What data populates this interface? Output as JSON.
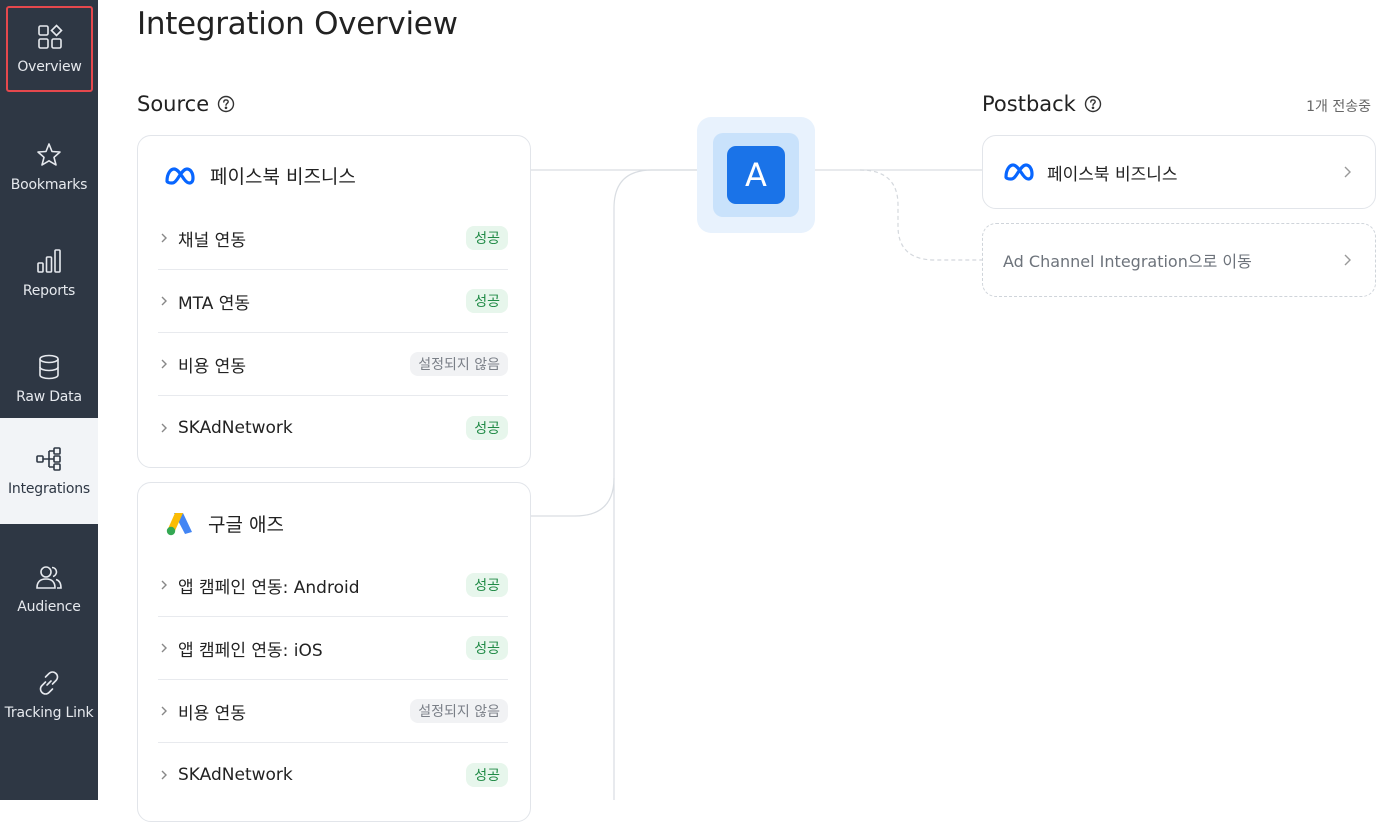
{
  "sidebar": {
    "items": [
      {
        "label": "Overview",
        "icon": "overview-grid-icon"
      },
      {
        "label": "Bookmarks",
        "icon": "star-icon"
      },
      {
        "label": "Reports",
        "icon": "bar-chart-icon"
      },
      {
        "label": "Raw Data",
        "icon": "database-icon"
      },
      {
        "label": "Integrations",
        "icon": "integrations-tree-icon"
      },
      {
        "label": "Audience",
        "icon": "users-icon"
      },
      {
        "label": "Tracking Link",
        "icon": "link-icon"
      }
    ]
  },
  "header": {
    "title": "Integration Overview"
  },
  "source": {
    "title": "Source",
    "cards": [
      {
        "name": "페이스북 비즈니스",
        "logo": "meta-logo",
        "rows": [
          {
            "label": "채널 연동",
            "status": "성공"
          },
          {
            "label": "MTA 연동",
            "status": "성공"
          },
          {
            "label": "비용 연동",
            "status": "설정되지 않음"
          },
          {
            "label": "SKAdNetwork",
            "status": "성공"
          }
        ]
      },
      {
        "name": "구글 애즈",
        "logo": "google-ads-logo",
        "rows": [
          {
            "label": "앱 캠페인 연동: Android",
            "status": "성공"
          },
          {
            "label": "앱 캠페인 연동: iOS",
            "status": "성공"
          },
          {
            "label": "비용 연동",
            "status": "설정되지 않음"
          },
          {
            "label": "SKAdNetwork",
            "status": "성공"
          }
        ]
      }
    ]
  },
  "hub": {
    "letter": "A"
  },
  "postback": {
    "title": "Postback",
    "count": "1개 전송중",
    "items": [
      {
        "label": "페이스북 비즈니스"
      },
      {
        "label": "Ad Channel Integration으로 이동"
      }
    ]
  },
  "colors": {
    "sidebar_bg": "#2e3744",
    "accent": "#1a73e8",
    "success_bg": "#e7f6ec",
    "success_text": "#1f8a45",
    "neutral_bg": "#f1f2f4",
    "highlight_border": "#e5484d"
  }
}
